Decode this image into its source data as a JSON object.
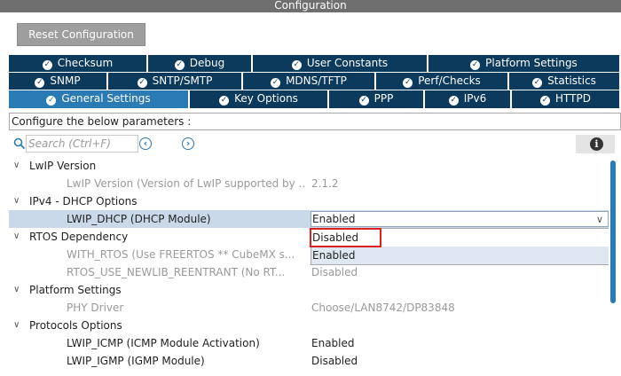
{
  "window": {
    "title": "Configuration"
  },
  "toolbar": {
    "reset_label": "Reset Configuration"
  },
  "tabs": {
    "row1": [
      {
        "label": "Checksum"
      },
      {
        "label": "Debug"
      },
      {
        "label": "User Constants"
      },
      {
        "label": "Platform Settings"
      }
    ],
    "row2": [
      {
        "label": "SNMP"
      },
      {
        "label": "SNTP/SMTP"
      },
      {
        "label": "MDNS/TFTP"
      },
      {
        "label": "Perf/Checks"
      },
      {
        "label": "Statistics"
      }
    ],
    "row3": [
      {
        "label": "General Settings",
        "active": true
      },
      {
        "label": "Key Options"
      },
      {
        "label": "PPP"
      },
      {
        "label": "IPv6"
      },
      {
        "label": "HTTPD"
      }
    ]
  },
  "configure_bar": {
    "text": "Configure the below parameters :"
  },
  "search": {
    "placeholder": "Search (Ctrl+F)"
  },
  "tree": {
    "groups": [
      {
        "label": "LwIP Version",
        "params": [
          {
            "name": "LwIP Version (Version of LwIP supported by ...",
            "value": "2.1.2",
            "muted": true
          }
        ]
      },
      {
        "label": "IPv4 - DHCP Options",
        "params": [
          {
            "name": "LWIP_DHCP (DHCP Module)",
            "value": "Enabled",
            "muted": false,
            "selected": true
          }
        ]
      },
      {
        "label": "RTOS Dependency",
        "params": [
          {
            "name": "WITH_RTOS (Use FREERTOS ** CubeMX s...",
            "value": "",
            "muted": true
          },
          {
            "name": "RTOS_USE_NEWLIB_REENTRANT (No RT...",
            "value": "Disabled",
            "muted": true
          }
        ]
      },
      {
        "label": "Platform Settings",
        "params": [
          {
            "name": "PHY Driver",
            "value": "Choose/LAN8742/DP83848",
            "muted": true
          }
        ]
      },
      {
        "label": "Protocols Options",
        "params": [
          {
            "name": "LWIP_ICMP (ICMP Module Activation)",
            "value": "Enabled",
            "muted": false
          },
          {
            "name": "LWIP_IGMP (IGMP Module)",
            "value": "Disabled",
            "muted": false
          }
        ]
      }
    ]
  },
  "dropdown": {
    "selected": "Enabled",
    "options": [
      "Disabled",
      "Enabled"
    ]
  },
  "colors": {
    "tab_dark": "#0b3a5d",
    "tab_active": "#2a7ab3",
    "highlight_red": "#e02020"
  }
}
